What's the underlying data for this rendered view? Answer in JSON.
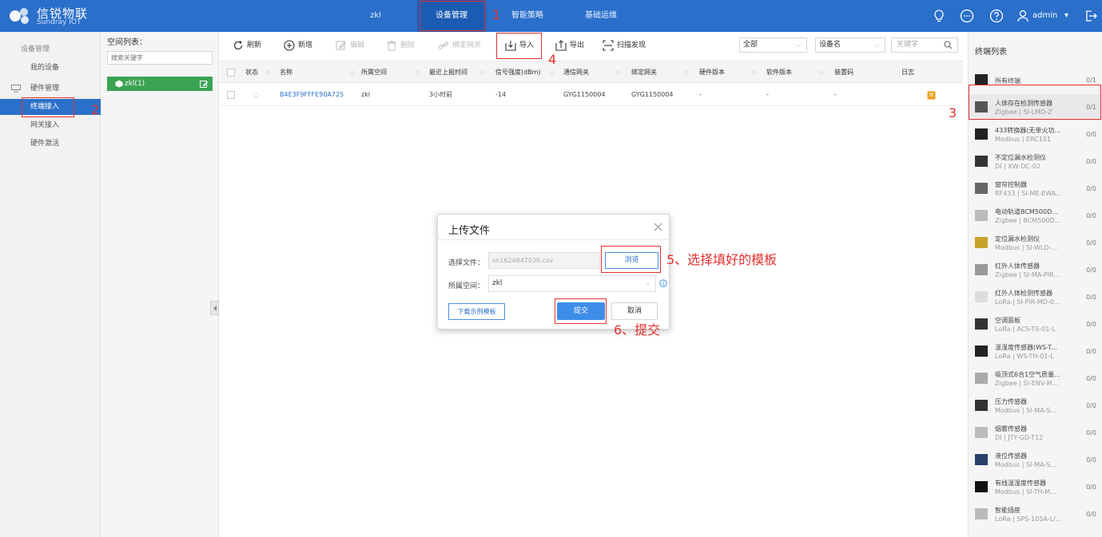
{
  "brand": {
    "name_cn": "信锐物联",
    "name_en": "Sundray IOT"
  },
  "topnav": [
    {
      "label": "zkl"
    },
    {
      "label": "设备管理"
    },
    {
      "label": "智能策略"
    },
    {
      "label": "基础运维"
    }
  ],
  "user": {
    "name": "admin",
    "caret": "▾"
  },
  "sidebar": {
    "items": [
      {
        "label": "设备管理"
      },
      {
        "label": "我的设备"
      },
      {
        "label": "硬件管理"
      },
      {
        "label": "终端接入"
      },
      {
        "label": "网关接入"
      },
      {
        "label": "硬件激活"
      }
    ]
  },
  "space": {
    "title": "空间列表：",
    "search_placeholder": "搜索关键字",
    "node": "zkl(1)"
  },
  "toolbar": {
    "refresh": "刷新",
    "add": "新增",
    "edit": "编辑",
    "delete": "删除",
    "bind_gateway": "绑定网关",
    "import": "导入",
    "export": "导出",
    "scan": "扫描发现",
    "filter_all": "全部",
    "filter_field": "设备名",
    "keyword_placeholder": "关键字"
  },
  "table": {
    "headers": [
      "状态",
      "名称",
      "所属空间",
      "最近上报时间",
      "信号强度(dBm)",
      "通信网关",
      "绑定网关",
      "硬件版本",
      "软件版本",
      "装置码",
      "日志"
    ],
    "rows": [
      {
        "status": "○",
        "name": "B4E3F9FFFE90A725",
        "space": "zkl",
        "last_report": "3小时前",
        "signal": "-14",
        "comm_gateway": "GYG1150004",
        "bind_gateway": "GYG1150004",
        "hw": "-",
        "sw": "-",
        "code": "-"
      }
    ]
  },
  "right_panel": {
    "title": "终端列表",
    "items": [
      {
        "name": "所有终端",
        "sub": "",
        "count": "0/1"
      },
      {
        "name": "人体存在检测传感器",
        "sub": "Zigbee | SI-LMD-Z",
        "count": "0/1"
      },
      {
        "name": "433转换器(无单火功...",
        "sub": "Modbus | ERC101",
        "count": "0/0"
      },
      {
        "name": "不定位漏水检测仪",
        "sub": "DI | XW-DC-02",
        "count": "0/0"
      },
      {
        "name": "窗帘控制器",
        "sub": "RF433 | SI-ME-EWA...",
        "count": "0/0"
      },
      {
        "name": "电动轨道BCM500D...",
        "sub": "Zigbee | BCM500D...",
        "count": "0/0"
      },
      {
        "name": "定位漏水检测仪",
        "sub": "Modbus | SI-WLD-...",
        "count": "0/0"
      },
      {
        "name": "红外人体传感器",
        "sub": "Zigbee | SI-MA-PIR...",
        "count": "0/0"
      },
      {
        "name": "红外人体检测传感器",
        "sub": "LoRa | SI-PIR-MD-0...",
        "count": "0/0"
      },
      {
        "name": "空调面板",
        "sub": "LoRa | ACS-TS-01-L",
        "count": "0/0"
      },
      {
        "name": "温湿度传感器(WS-T...",
        "sub": "LoRa | WS-TH-01-L",
        "count": "0/0"
      },
      {
        "name": "吸顶式6合1空气质量...",
        "sub": "Zigbee | SI-ENV-M...",
        "count": "0/0"
      },
      {
        "name": "压力传感器",
        "sub": "Modbus | SI-MA-S...",
        "count": "0/0"
      },
      {
        "name": "烟雾传感器",
        "sub": "DI | JTY-GD-T12",
        "count": "0/0"
      },
      {
        "name": "液位传感器",
        "sub": "Modbus | SI-MA-S...",
        "count": "0/0"
      },
      {
        "name": "有线温湿度传感器",
        "sub": "Modbus | SI-TH-M...",
        "count": "0/0"
      },
      {
        "name": "智能插座",
        "sub": "LoRa | SPS-105A-L/...",
        "count": "0/0"
      }
    ]
  },
  "modal": {
    "title": "上传文件",
    "file_label": "选择文件：",
    "file_value": "sn1624847036.csv",
    "browse": "浏览",
    "space_label": "所属空间：",
    "space_value": "zkl",
    "download_template": "下载示例模板",
    "submit": "提交",
    "cancel": "取消"
  },
  "annotations": {
    "n1": "1",
    "n2": "2",
    "n3": "3",
    "n4": "4",
    "n5": "5、选择填好的模板",
    "n6": "6、提交"
  },
  "colors": {
    "primary": "#2a6fc9",
    "green": "#3ba352",
    "annotation": "#e53030"
  }
}
